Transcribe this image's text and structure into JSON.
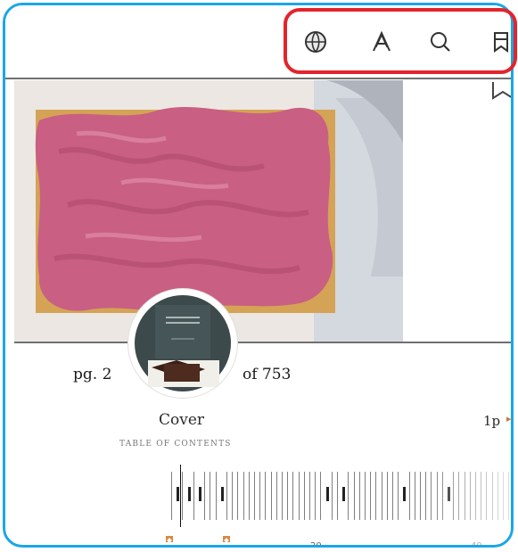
{
  "toolbar": {
    "icons": [
      "globe-icon",
      "font-icon",
      "search-icon",
      "bookmarks-icon"
    ]
  },
  "reader": {
    "pg_prefix": "pg. 2",
    "of_total": "of 753",
    "chapter": "Cover",
    "toc": "TABLE OF CONTENTS",
    "pages_left": "1p",
    "chevron": "▸"
  },
  "scrubber": {
    "labels": [
      "20",
      "40"
    ]
  },
  "cover_thumb": {
    "title": "GENIUS DESSERTS"
  },
  "colors": {
    "frame": "#1aa7e6",
    "highlight": "#e3242b",
    "accent": "#d78a46"
  }
}
